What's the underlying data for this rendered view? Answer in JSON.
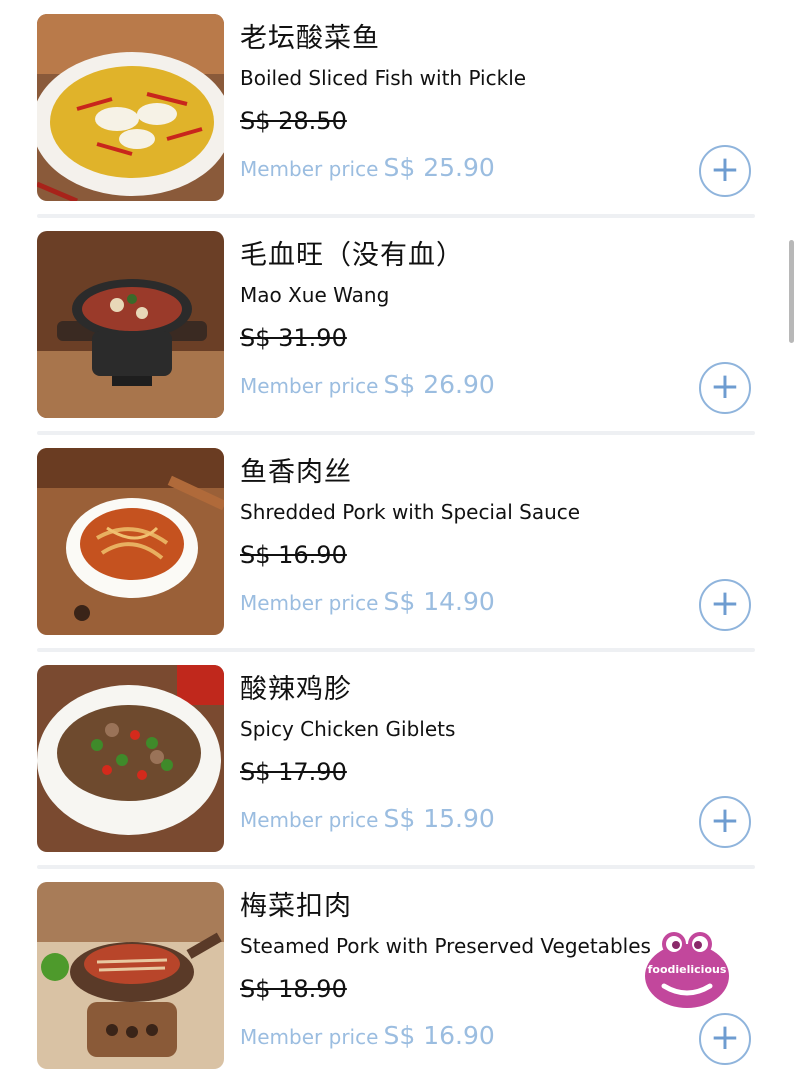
{
  "items": [
    {
      "name_cn": "老坛酸菜鱼",
      "name_en": "Boiled Sliced Fish with Pickle",
      "original_price": "S$ 28.50",
      "member_label": "Member price",
      "member_price": "S$ 25.90",
      "image": "fish-pickle-dish"
    },
    {
      "name_cn": "毛血旺（没有血）",
      "name_en": "Mao Xue Wang",
      "original_price": "S$ 31.90",
      "member_label": "Member price",
      "member_price": "S$ 26.90",
      "image": "mao-xue-wang-pot"
    },
    {
      "name_cn": "鱼香肉丝",
      "name_en": "Shredded Pork with Special Sauce",
      "original_price": "S$ 16.90",
      "member_label": "Member price",
      "member_price": "S$ 14.90",
      "image": "shredded-pork-bowl"
    },
    {
      "name_cn": "酸辣鸡胗",
      "name_en": "Spicy Chicken Giblets",
      "original_price": "S$ 17.90",
      "member_label": "Member price",
      "member_price": "S$ 15.90",
      "image": "chicken-giblets-bowl"
    },
    {
      "name_cn": "梅菜扣肉",
      "name_en": "Steamed Pork with Preserved Vegetables",
      "original_price": "S$ 18.90",
      "member_label": "Member price",
      "member_price": "S$ 16.90",
      "image": "steamed-pork-pot"
    }
  ],
  "add_button_symbol": "+",
  "watermark": {
    "text": "foodielicious",
    "color": "#c2479c"
  },
  "colors": {
    "member_price": "#9bbde0",
    "add_button": "#8fb4dc",
    "divider": "#eef0f3"
  }
}
